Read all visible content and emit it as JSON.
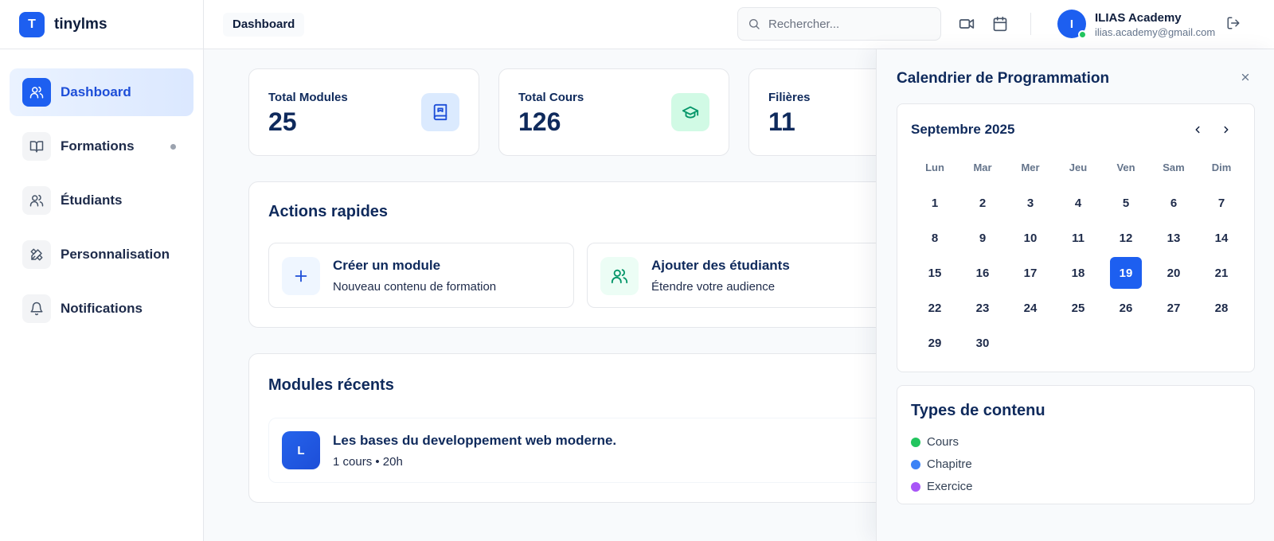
{
  "brand": {
    "logo_letter": "T",
    "name": "tinylms"
  },
  "sidebar": {
    "items": [
      {
        "label": "Dashboard",
        "icon": "users-icon",
        "active": true
      },
      {
        "label": "Formations",
        "icon": "book-open-icon",
        "has_dot": true
      },
      {
        "label": "Étudiants",
        "icon": "users-icon"
      },
      {
        "label": "Personnalisation",
        "icon": "design-tools-icon"
      },
      {
        "label": "Notifications",
        "icon": "bell-icon"
      }
    ]
  },
  "header": {
    "breadcrumb": "Dashboard",
    "search_placeholder": "Rechercher...",
    "user": {
      "initial": "I",
      "name": "ILIAS Academy",
      "email": "ilias.academy@gmail.com",
      "online": true
    }
  },
  "stats": [
    {
      "label": "Total Modules",
      "value": "25",
      "icon": "book-icon",
      "color": "#1d4ed8",
      "bg": "#dbeafe"
    },
    {
      "label": "Total Cours",
      "value": "126",
      "icon": "graduation-cap-icon",
      "color": "#059669",
      "bg": "#d1fae5"
    },
    {
      "label": "Filières",
      "value": "11"
    }
  ],
  "quick_actions": {
    "title": "Actions rapides",
    "items": [
      {
        "title": "Créer un module",
        "subtitle": "Nouveau contenu de formation",
        "icon": "plus-icon",
        "color": "#1d4ed8",
        "bg": "#eff6ff"
      },
      {
        "title": "Ajouter des étudiants",
        "subtitle": "Étendre votre audience",
        "icon": "users-icon",
        "color": "#059669",
        "bg": "#ecfdf5"
      }
    ]
  },
  "recent_modules": {
    "title": "Modules récents",
    "items": [
      {
        "initial": "L",
        "title": "Les bases du developpement web moderne.",
        "meta": "1 cours • 20h"
      }
    ]
  },
  "calendar": {
    "title": "Calendrier de Programmation",
    "month_label": "Septembre 2025",
    "weekdays": [
      "Lun",
      "Mar",
      "Mer",
      "Jeu",
      "Ven",
      "Sam",
      "Dim"
    ],
    "days": [
      "1",
      "2",
      "3",
      "4",
      "5",
      "6",
      "7",
      "8",
      "9",
      "10",
      "11",
      "12",
      "13",
      "14",
      "15",
      "16",
      "17",
      "18",
      "19",
      "20",
      "21",
      "22",
      "23",
      "24",
      "25",
      "26",
      "27",
      "28",
      "29",
      "30"
    ],
    "selected_day": "19",
    "accent": "#1d5ff0"
  },
  "content_types": {
    "title": "Types de contenu",
    "items": [
      {
        "label": "Cours",
        "color": "#22c55e"
      },
      {
        "label": "Chapitre",
        "color": "#3b82f6"
      },
      {
        "label": "Exercice",
        "color": "#a855f7"
      }
    ]
  }
}
